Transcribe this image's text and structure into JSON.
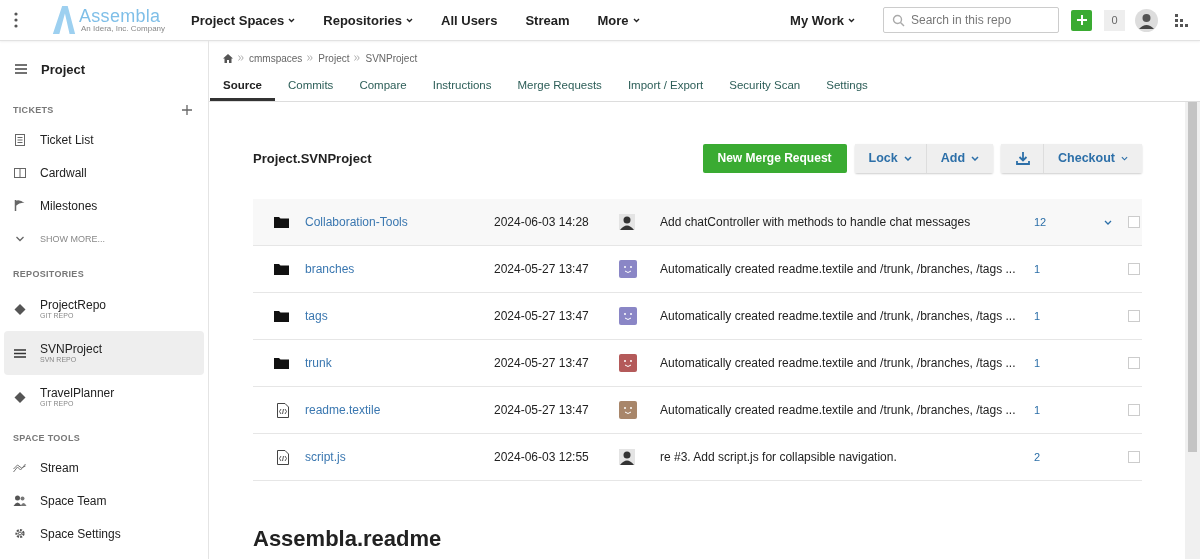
{
  "header": {
    "logo": {
      "name": "Assembla",
      "tagline": "An Idera, Inc. Company"
    },
    "nav": [
      {
        "label": "Project Spaces",
        "has_menu": true
      },
      {
        "label": "Repositories",
        "has_menu": true
      },
      {
        "label": "All Users",
        "has_menu": false
      },
      {
        "label": "Stream",
        "has_menu": false
      },
      {
        "label": "More",
        "has_menu": true
      }
    ],
    "my_work": {
      "label": "My Work",
      "has_menu": true
    },
    "search": {
      "placeholder": "Search in this repo"
    },
    "notifications": "0"
  },
  "sidebar": {
    "title": "Project",
    "sections": [
      {
        "heading": "TICKETS",
        "addable": true,
        "items": [
          {
            "kind": "list",
            "label": "Ticket List",
            "selected": false
          },
          {
            "kind": "board",
            "label": "Cardwall",
            "selected": false
          },
          {
            "kind": "flag",
            "label": "Milestones",
            "selected": false
          },
          {
            "kind": "more",
            "label": "SHOW MORE...",
            "selected": false
          }
        ]
      },
      {
        "heading": "REPOSITORIES",
        "addable": false,
        "items": [
          {
            "kind": "git",
            "label": "ProjectRepo",
            "sub": "GIT REPO",
            "selected": false
          },
          {
            "kind": "svn",
            "label": "SVNProject",
            "sub": "SVN REPO",
            "selected": true
          },
          {
            "kind": "git",
            "label": "TravelPlanner",
            "sub": "GIT REPO",
            "selected": false
          }
        ]
      },
      {
        "heading": "SPACE TOOLS",
        "addable": false,
        "items": [
          {
            "kind": "stream",
            "label": "Stream",
            "selected": false
          },
          {
            "kind": "team",
            "label": "Space Team",
            "selected": false
          },
          {
            "kind": "gear",
            "label": "Space Settings",
            "selected": false
          }
        ]
      }
    ]
  },
  "breadcrumb": [
    "cmmspaces",
    "Project",
    "SVNProject"
  ],
  "tabs": [
    {
      "label": "Source",
      "selected": true
    },
    {
      "label": "Commits",
      "selected": false
    },
    {
      "label": "Compare",
      "selected": false
    },
    {
      "label": "Instructions",
      "selected": false
    },
    {
      "label": "Merge Requests",
      "selected": false
    },
    {
      "label": "Import / Export",
      "selected": false
    },
    {
      "label": "Security Scan",
      "selected": false
    },
    {
      "label": "Settings",
      "selected": false
    }
  ],
  "repo": {
    "title": "Project.SVNProject",
    "buttons": {
      "merge": "New Merge Request",
      "lock": "Lock",
      "add": "Add",
      "checkout": "Checkout"
    },
    "files": [
      {
        "kind": "folder",
        "name": "Collaboration-Tools",
        "date": "2024-06-03 14:28",
        "avatar": {
          "kind": "photo"
        },
        "message": "Add chatController with methods to handle chat messages",
        "count": "12",
        "hovered": true,
        "checked": false
      },
      {
        "kind": "folder",
        "name": "branches",
        "date": "2024-05-27 13:47",
        "avatar": {
          "kind": "identicon",
          "color": "#8a86c6"
        },
        "message": "Automatically created readme.textile and /trunk, /branches, /tags ...",
        "count": "1",
        "hovered": false,
        "checked": false
      },
      {
        "kind": "folder",
        "name": "tags",
        "date": "2024-05-27 13:47",
        "avatar": {
          "kind": "identicon",
          "color": "#8a86c6"
        },
        "message": "Automatically created readme.textile and /trunk, /branches, /tags ...",
        "count": "1",
        "hovered": false,
        "checked": false
      },
      {
        "kind": "folder",
        "name": "trunk",
        "date": "2024-05-27 13:47",
        "avatar": {
          "kind": "identicon",
          "color": "#b45a5a"
        },
        "message": "Automatically created readme.textile and /trunk, /branches, /tags ...",
        "count": "1",
        "hovered": false,
        "checked": false
      },
      {
        "kind": "file",
        "name": "readme.textile",
        "date": "2024-05-27 13:47",
        "avatar": {
          "kind": "identicon",
          "color": "#a8866a"
        },
        "message": "Automatically created readme.textile and /trunk, /branches, /tags ...",
        "count": "1",
        "hovered": false,
        "checked": false
      },
      {
        "kind": "file",
        "name": "script.js",
        "date": "2024-06-03 12:55",
        "avatar": {
          "kind": "photo"
        },
        "message": "re #3. Add script.js for collapsible navigation.",
        "count": "2",
        "hovered": false,
        "checked": false
      }
    ],
    "readme_title": "Assembla.readme"
  }
}
